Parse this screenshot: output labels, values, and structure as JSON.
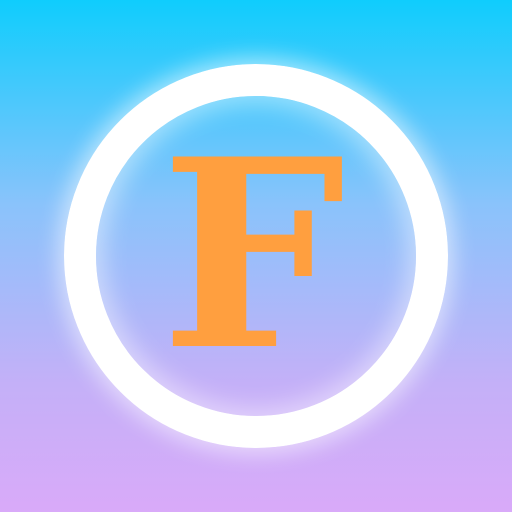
{
  "icon": {
    "letter": "F",
    "letter_color": "#ff9f3f",
    "ring_color": "#ffffff",
    "background_top": "#0fcdfd",
    "background_bottom": "#d9aaf9"
  }
}
